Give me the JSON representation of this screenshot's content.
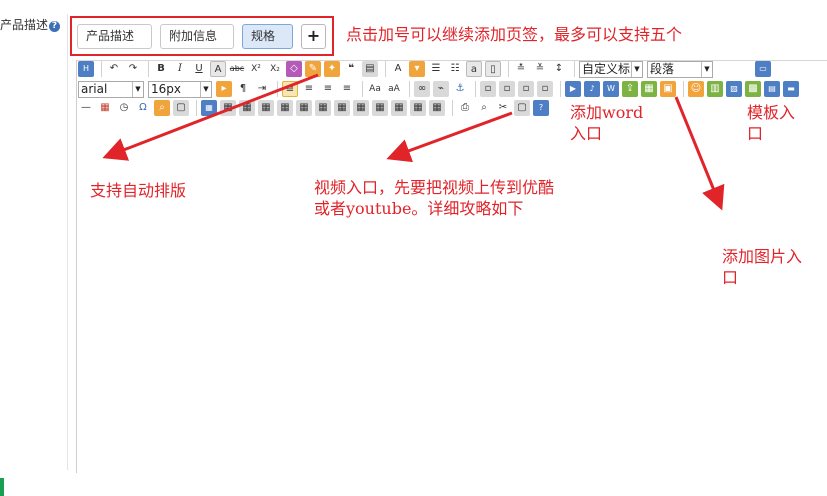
{
  "field": {
    "label": "产品描述",
    "help_icon": "question-circle-icon"
  },
  "tabs": [
    {
      "label": "产品描述",
      "active": false
    },
    {
      "label": "附加信息",
      "active": false
    },
    {
      "label": "规格",
      "active": true
    }
  ],
  "add_tab": {
    "label": "+"
  },
  "toolbar": {
    "font_family": "arial",
    "font_size": "16px",
    "custom_title": "自定义标",
    "paragraph": "段落"
  },
  "annotations": {
    "tabs_note": "点击加号可以继续添加页签，最多可以支持五个",
    "auto_layout": "支持自动排版",
    "video_line1": "视频入口，先要把视频上传到优酷",
    "video_line2": "或者youtube。详细攻略如下",
    "word_line1": "添加word",
    "word_line2": "入口",
    "template_line1": "模板入",
    "template_line2": "口",
    "image_line1": "添加图片入",
    "image_line2": "口"
  },
  "colors": {
    "annotation": "#e0242a",
    "active_tab": "#dce8f8",
    "accent": "#1aa053"
  }
}
